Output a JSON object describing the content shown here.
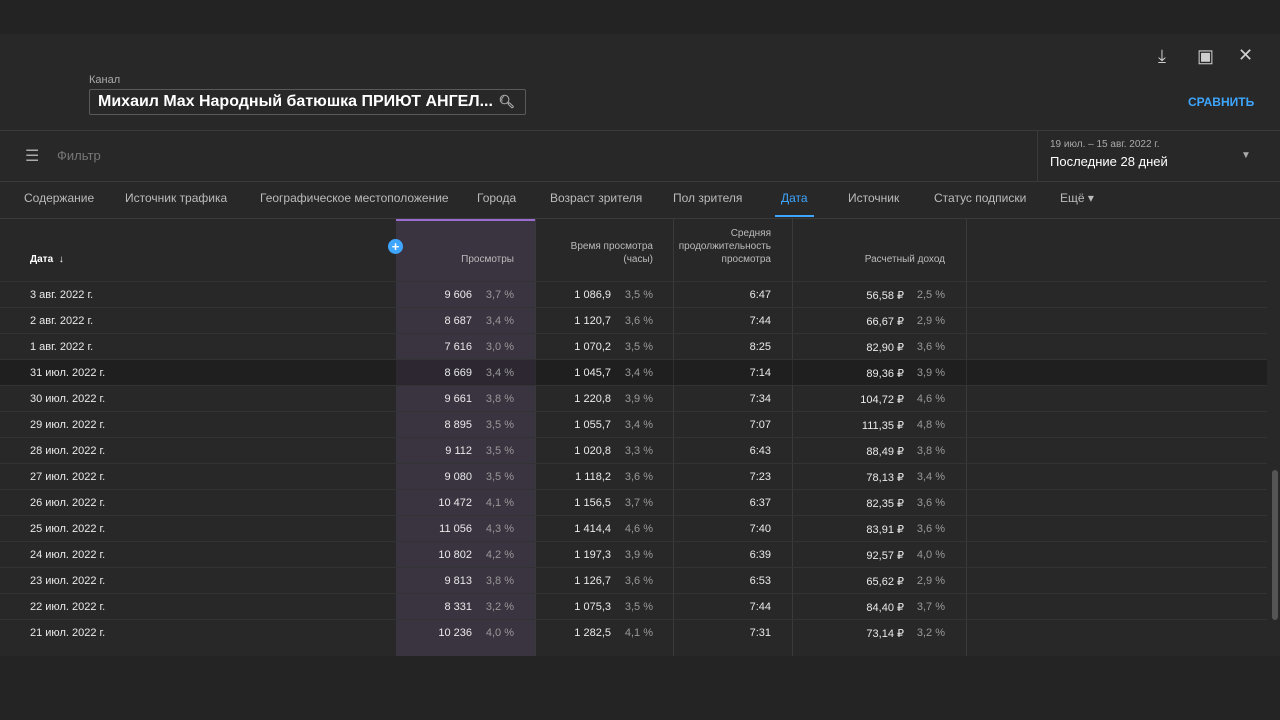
{
  "header": {
    "channel_label": "Канал",
    "channel_value": "Михаил Max Народный батюшка ПРИЮТ АНГЕЛ...",
    "compare_label": "СРАВНИТЬ",
    "icons": [
      "download-icon",
      "feedback-icon",
      "close-icon",
      "search-icon"
    ]
  },
  "filter": {
    "placeholder": "Фильтр",
    "date_range": "19 июл. – 15 авг. 2022 г.",
    "period": "Последние 28 дней"
  },
  "tabs": [
    "Содержание",
    "Источник трафика",
    "Географическое местоположение",
    "Города",
    "Возраст зрителя",
    "Пол зрителя",
    "Дата",
    "Источник",
    "Статус подписки",
    "Ещё ▾"
  ],
  "active_tab": "Дата",
  "table": {
    "headers": {
      "date": "Дата",
      "views": "Просмотры",
      "watch1": "Время просмотра",
      "watch2": "(часы)",
      "avg1": "Средняя",
      "avg2": "продолжительность",
      "avg3": "просмотра",
      "revenue": "Расчетный доход"
    },
    "rows": [
      [
        "3 авг. 2022 г.",
        "9 606",
        "3,7 %",
        "1 086,9",
        "3,5 %",
        "6:47",
        "56,58 ₽",
        "2,5 %"
      ],
      [
        "2 авг. 2022 г.",
        "8 687",
        "3,4 %",
        "1 120,7",
        "3,6 %",
        "7:44",
        "66,67 ₽",
        "2,9 %"
      ],
      [
        "1 авг. 2022 г.",
        "7 616",
        "3,0 %",
        "1 070,2",
        "3,5 %",
        "8:25",
        "82,90 ₽",
        "3,6 %"
      ],
      [
        "31 июл. 2022 г.",
        "8 669",
        "3,4 %",
        "1 045,7",
        "3,4 %",
        "7:14",
        "89,36 ₽",
        "3,9 %"
      ],
      [
        "30 июл. 2022 г.",
        "9 661",
        "3,8 %",
        "1 220,8",
        "3,9 %",
        "7:34",
        "104,72 ₽",
        "4,6 %"
      ],
      [
        "29 июл. 2022 г.",
        "8 895",
        "3,5 %",
        "1 055,7",
        "3,4 %",
        "7:07",
        "111,35 ₽",
        "4,8 %"
      ],
      [
        "28 июл. 2022 г.",
        "9 112",
        "3,5 %",
        "1 020,8",
        "3,3 %",
        "6:43",
        "88,49 ₽",
        "3,8 %"
      ],
      [
        "27 июл. 2022 г.",
        "9 080",
        "3,5 %",
        "1 118,2",
        "3,6 %",
        "7:23",
        "78,13 ₽",
        "3,4 %"
      ],
      [
        "26 июл. 2022 г.",
        "10 472",
        "4,1 %",
        "1 156,5",
        "3,7 %",
        "6:37",
        "82,35 ₽",
        "3,6 %"
      ],
      [
        "25 июл. 2022 г.",
        "11 056",
        "4,3 %",
        "1 414,4",
        "4,6 %",
        "7:40",
        "83,91 ₽",
        "3,6 %"
      ],
      [
        "24 июл. 2022 г.",
        "10 802",
        "4,2 %",
        "1 197,3",
        "3,9 %",
        "6:39",
        "92,57 ₽",
        "4,0 %"
      ],
      [
        "23 июл. 2022 г.",
        "9 813",
        "3,8 %",
        "1 126,7",
        "3,6 %",
        "6:53",
        "65,62 ₽",
        "2,9 %"
      ],
      [
        "22 июл. 2022 г.",
        "8 331",
        "3,2 %",
        "1 075,3",
        "3,5 %",
        "7:44",
        "84,40 ₽",
        "3,7 %"
      ],
      [
        "21 июл. 2022 г.",
        "10 236",
        "4,0 %",
        "1 282,5",
        "4,1 %",
        "7:31",
        "73,14 ₽",
        "3,2 %"
      ]
    ]
  },
  "colors": {
    "accent": "#3ea6ff",
    "views_highlight": "#9a6ccf"
  }
}
